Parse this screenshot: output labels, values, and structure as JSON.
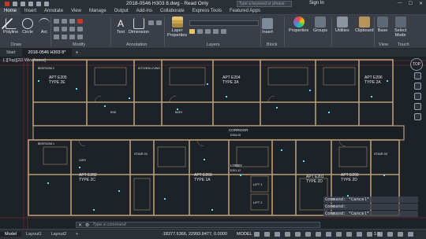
{
  "titlebar": {
    "title": "2018-0546 H303 8.dwg - Read Only",
    "search_placeholder": "Type a keyword or phrase",
    "signin": "Sign In",
    "controls": [
      "—",
      "☐",
      "✕"
    ]
  },
  "tabs": [
    "Home",
    "Insert",
    "Annotate",
    "View",
    "Manage",
    "Output",
    "Add-ins",
    "Collaborate",
    "Express Tools",
    "Featured Apps"
  ],
  "ribbon": {
    "buttons": {
      "polyline": "Polyline",
      "circle": "Circle",
      "arc": "Arc",
      "text": "Text",
      "dimension": "Dimension",
      "layer_properties_1": "Layer",
      "layer_properties_2": "Properties",
      "insert": "Insert",
      "properties": "Properties",
      "groups": "Groups",
      "utilities": "Utilities",
      "clipboard": "Clipboard",
      "base": "Base",
      "select_mode_1": "Select",
      "select_mode_2": "Mode"
    },
    "panels": {
      "draw": "Draw",
      "modify": "Modify",
      "annotation": "Annotation",
      "layers": "Layers",
      "block": "Block",
      "view": "View",
      "touch": "Touch"
    }
  },
  "doc_tabs": {
    "start": "Start",
    "file": "2018-0546 H303 8*",
    "plus": "+"
  },
  "drawing": {
    "viewport_label": "[-][Top][2D Wireframe]",
    "compass_label": "TOP",
    "rooms_top": [
      {
        "name": "APT E205",
        "type": "TYPE 2E"
      },
      {
        "name": "APT E204",
        "type": "TYPE 2A"
      },
      {
        "name": "APT E206",
        "type": "TYPE 2A"
      }
    ],
    "rooms_bottom": [
      {
        "name": "APT E202",
        "type": "TYPE 2C"
      },
      {
        "name": "APT E203",
        "type": "TYPE 1A"
      },
      {
        "name": "APT E201",
        "type": "TYPE 2D"
      },
      {
        "name": "APT E200",
        "type": "TYPE 2D"
      }
    ],
    "labels": {
      "corridor": "CORRIDOR",
      "corridor_num": "E206-00",
      "lobby": "LOBBY",
      "lobby_num": "E201-12",
      "lift1": "LIFT 1",
      "lift2": "LIFT 2",
      "stair1": "STAIR 01",
      "stair2": "STAIR 02",
      "bedroom1": "BEDROOM 1",
      "bedroom2": "BEDROOM 2",
      "kitchen": "KITCHEN LIVING",
      "ens": "ENS",
      "bath": "BATH",
      "ldry": "LDRY"
    }
  },
  "command_history": [
    "Command: *Cancel*",
    "Command:",
    "Command: *Cancel*"
  ],
  "command_input": {
    "placeholder": "Type a command"
  },
  "status": {
    "layouts": [
      "Model",
      "Layout1",
      "Layout2"
    ],
    "coordinates": "-18377.5366, 22993.8477, 0.0000",
    "model": "MODEL",
    "scale": "1:1"
  },
  "colors": {
    "wall": "#c9b08a",
    "wall_dark": "#9c8668",
    "dim": "#b23b3b",
    "annot": "#8fd4e8",
    "text": "#e6e6e6",
    "accent_cyan": "#5ee0ff"
  }
}
